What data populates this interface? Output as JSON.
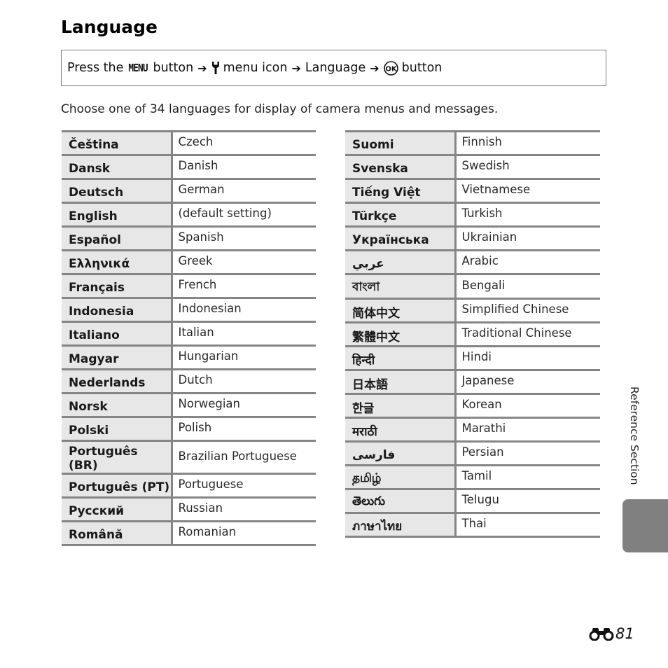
{
  "page": {
    "title": "Language",
    "procedure": {
      "press_the": "Press the",
      "menu_label": "MENU",
      "button_1": "button",
      "menu_icon_text": "menu icon",
      "language": "Language",
      "button_2": "button",
      "arrow_icon": "arrow-right-icon",
      "setup_icon": "wrench-icon",
      "ok_icon": "ok-button-icon",
      "arrow_glyph": "➔"
    },
    "description": "Choose one of 34 languages for display of camera menus and messages.",
    "side_tab_label": "Reference Section",
    "page_number": {
      "prefix_icon": "binoculars-icon",
      "number": "81"
    }
  },
  "languages_left": [
    {
      "native": "Čeština",
      "english": "Czech"
    },
    {
      "native": "Dansk",
      "english": "Danish"
    },
    {
      "native": "Deutsch",
      "english": "German"
    },
    {
      "native": "English",
      "english": "(default setting)"
    },
    {
      "native": "Español",
      "english": "Spanish"
    },
    {
      "native": "Ελληνικά",
      "english": "Greek"
    },
    {
      "native": "Français",
      "english": "French"
    },
    {
      "native": "Indonesia",
      "english": "Indonesian"
    },
    {
      "native": "Italiano",
      "english": "Italian"
    },
    {
      "native": "Magyar",
      "english": "Hungarian"
    },
    {
      "native": "Nederlands",
      "english": "Dutch"
    },
    {
      "native": "Norsk",
      "english": "Norwegian"
    },
    {
      "native": "Polski",
      "english": "Polish"
    },
    {
      "native": "Português (BR)",
      "english": "Brazilian Portuguese"
    },
    {
      "native": "Português (PT)",
      "english": "Portuguese"
    },
    {
      "native": "Русский",
      "english": "Russian"
    },
    {
      "native": "Română",
      "english": "Romanian"
    }
  ],
  "languages_right": [
    {
      "native": "Suomi",
      "english": "Finnish"
    },
    {
      "native": "Svenska",
      "english": "Swedish"
    },
    {
      "native": "Tiếng Việt",
      "english": "Vietnamese"
    },
    {
      "native": "Türkçe",
      "english": "Turkish"
    },
    {
      "native": "Українська",
      "english": "Ukrainian"
    },
    {
      "native": "عربي",
      "english": "Arabic"
    },
    {
      "native": "বাংলা",
      "english": "Bengali"
    },
    {
      "native": "简体中文",
      "english": "Simplified Chinese"
    },
    {
      "native": "繁體中文",
      "english": "Traditional Chinese"
    },
    {
      "native": "हिन्दी",
      "english": "Hindi"
    },
    {
      "native": "日本語",
      "english": "Japanese"
    },
    {
      "native": "한글",
      "english": "Korean"
    },
    {
      "native": "मराठी",
      "english": "Marathi"
    },
    {
      "native": "فارسی",
      "english": "Persian"
    },
    {
      "native": "தமிழ்",
      "english": "Tamil"
    },
    {
      "native": "తెలుగు",
      "english": "Telugu"
    },
    {
      "native": "ภาษาไทย",
      "english": "Thai"
    }
  ]
}
